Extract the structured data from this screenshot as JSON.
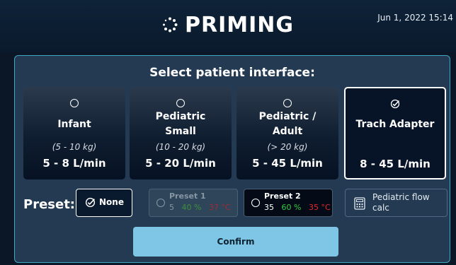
{
  "header": {
    "title": "PRIMING",
    "date": "Jun 1, 2022 15:14"
  },
  "panel": {
    "title": "Select patient interface:"
  },
  "interfaces": [
    {
      "name": "Infant",
      "weight": "(5 - 10 kg)",
      "flow": "5 - 8 L/min",
      "selected": false
    },
    {
      "name": "Pediatric Small",
      "weight": "(10 - 20 kg)",
      "flow": "5 - 20 L/min",
      "selected": false
    },
    {
      "name": "Pediatric / Adult",
      "weight": "(> 20 kg)",
      "flow": "5 - 45 L/min",
      "selected": false
    },
    {
      "name": "Trach Adapter",
      "weight": "",
      "flow": "8 - 45 L/min",
      "selected": true
    }
  ],
  "card_name_lines": {
    "pediatric_small_1": "Pediatric",
    "pediatric_small_2": "Small",
    "pediatric_adult_1": "Pediatric /",
    "pediatric_adult_2": "Adult"
  },
  "preset": {
    "label": "Preset:",
    "none_label": "None",
    "preset1": {
      "title": "Preset 1",
      "flow": "5",
      "oxygen": "40 %",
      "temp": "37 °C",
      "enabled": false
    },
    "preset2": {
      "title": "Preset 2",
      "flow": "35",
      "oxygen": "60 %",
      "temp": "35 °C",
      "enabled": true
    },
    "calc_label": "Pediatric flow calc"
  },
  "confirm_label": "Confirm",
  "colors": {
    "accent_border": "#3ea9c6",
    "confirm_bg": "#7fc6e6",
    "oxygen_green": "#2ecc40",
    "temp_red": "#e8282c"
  },
  "icons": [
    "spinner-icon",
    "radio-icon",
    "check-icon",
    "calculator-icon"
  ]
}
